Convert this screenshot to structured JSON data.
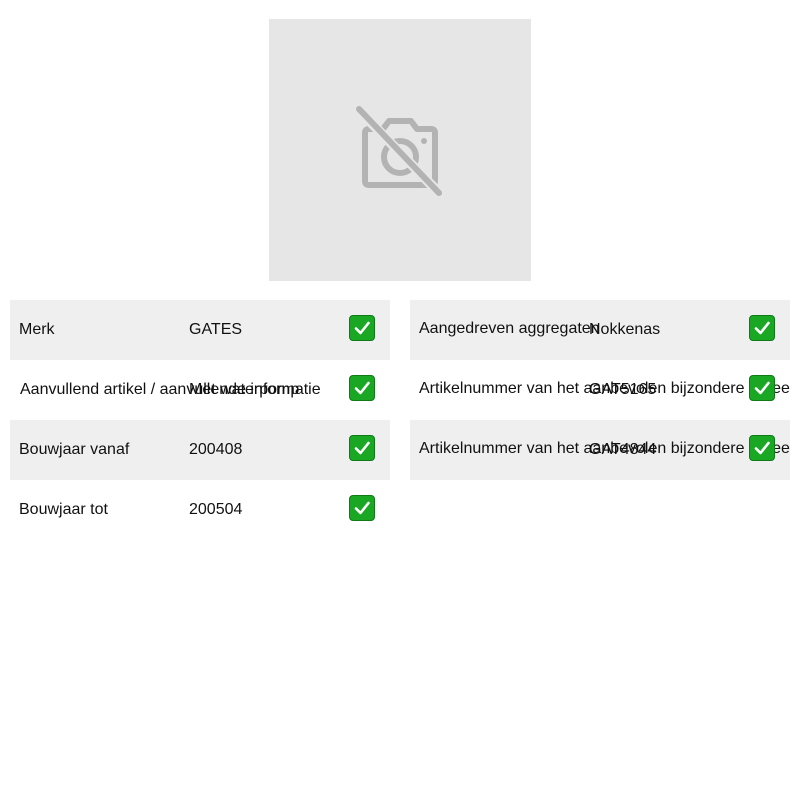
{
  "product_image": {
    "icon": "no-camera-icon",
    "background": "#e6e6e6"
  },
  "spec_left": [
    {
      "label": "Merk",
      "value": "GATES",
      "check_icon": "check-icon"
    },
    {
      "label": "Aanvullend artikel / aanvullende informatie",
      "value": "Met waterpomp",
      "check_icon": "check-icon"
    },
    {
      "label": "Bouwjaar vanaf",
      "value": "200408",
      "check_icon": "check-icon"
    },
    {
      "label": "Bouwjaar tot",
      "value": "200504",
      "check_icon": "check-icon"
    }
  ],
  "spec_right": [
    {
      "label": "Aangedreven aggregaten",
      "value": "Nokkenas",
      "check_icon": "check-icon"
    },
    {
      "label": "Artikelnummer van het aanbevolen bijzondere gereedschap",
      "value": "GAT5165",
      "check_icon": "check-icon"
    },
    {
      "label": "Artikelnummer van het aanbevolen bijzondere gereedschap",
      "value": "GAT4844",
      "check_icon": "check-icon"
    }
  ],
  "colors": {
    "row_shade": "#efefef",
    "check_green": "#1aa824",
    "placeholder_gray": "#b3b3b3"
  }
}
